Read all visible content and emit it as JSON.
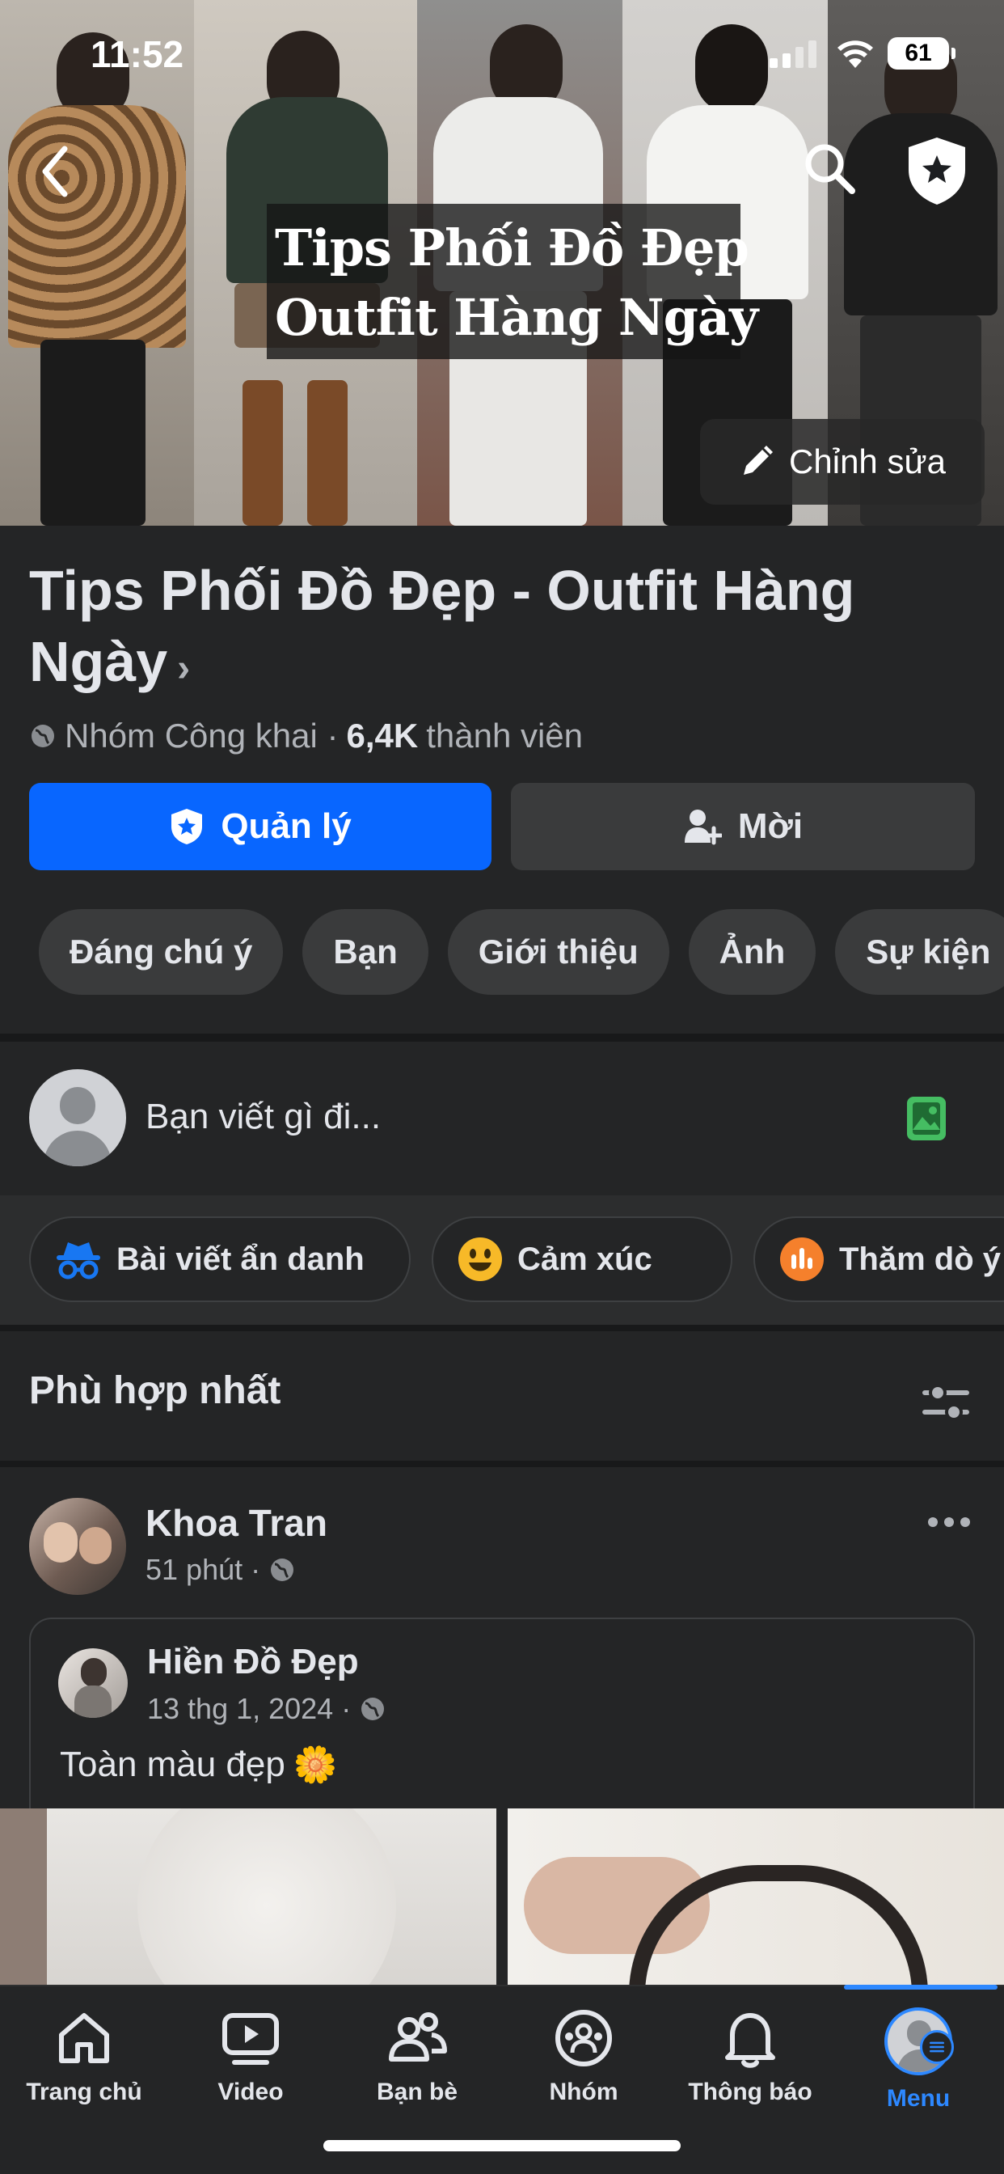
{
  "status_bar": {
    "time": "11:52",
    "battery": "61"
  },
  "cover": {
    "title_line1": "Tips Phối Đồ Đẹp",
    "title_line2": "Outfit Hàng Ngày",
    "edit_label": "Chỉnh sửa"
  },
  "group": {
    "name": "Tips Phối Đồ Đẹp - Outfit Hàng Ngày",
    "privacy": "Nhóm Công khai ·",
    "members_count": "6,4K",
    "members_label": "thành viên",
    "manage_label": "Quản lý",
    "invite_label": "Mời",
    "tabs": [
      "Đáng chú ý",
      "Bạn",
      "Giới thiệu",
      "Ảnh",
      "Sự kiện"
    ]
  },
  "composer": {
    "placeholder": "Bạn viết gì đi...",
    "actions": [
      "Bài viết ẩn danh",
      "Cảm xúc",
      "Thăm dò ý"
    ]
  },
  "feed": {
    "sort_label": "Phù hợp nhất"
  },
  "post": {
    "author": "Khoa Tran",
    "time": "51 phút ·",
    "shared": {
      "author": "Hiền Đồ Đẹp",
      "time": "13 thg 1, 2024 ·",
      "text": "Toàn màu đẹp",
      "emoji": "🌼"
    }
  },
  "bottom_nav": {
    "items": [
      {
        "label": "Trang chủ",
        "icon": "home-icon"
      },
      {
        "label": "Video",
        "icon": "video-icon"
      },
      {
        "label": "Bạn bè",
        "icon": "friends-icon"
      },
      {
        "label": "Nhóm",
        "icon": "groups-icon"
      },
      {
        "label": "Thông báo",
        "icon": "bell-icon"
      },
      {
        "label": "Menu",
        "icon": "avatar-menu-icon"
      }
    ],
    "active": "Menu"
  },
  "colors": {
    "accent": "#0866ff",
    "active_nav": "#2d88ff",
    "background": "#242526"
  }
}
